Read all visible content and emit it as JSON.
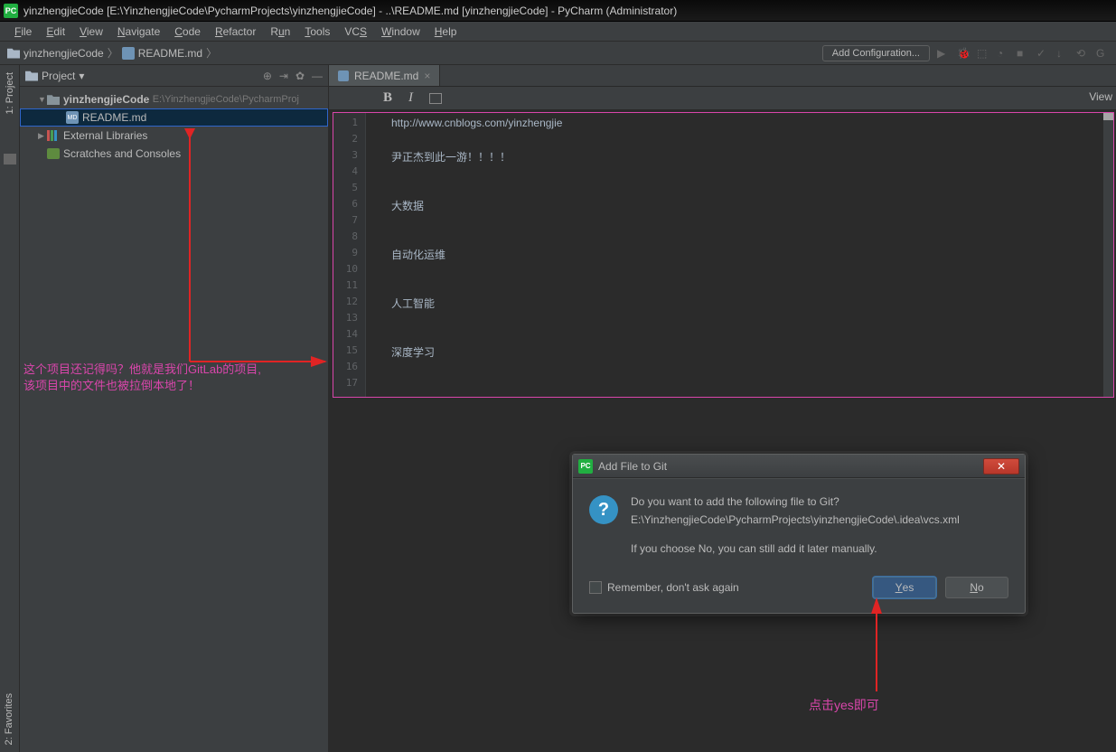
{
  "titlebar": {
    "text": "yinzhengjieCode [E:\\YinzhengjieCode\\PycharmProjects\\yinzhengjieCode] - ..\\README.md [yinzhengjieCode] - PyCharm (Administrator)"
  },
  "menubar": {
    "file": "File",
    "edit": "Edit",
    "view": "View",
    "navigate": "Navigate",
    "code": "Code",
    "refactor": "Refactor",
    "run": "Run",
    "tools": "Tools",
    "vcs": "VCS",
    "window": "Window",
    "help": "Help"
  },
  "breadcrumb": {
    "root": "yinzhengjieCode",
    "file": "README.md"
  },
  "run": {
    "add_config": "Add Configuration..."
  },
  "left_gutter": {
    "project_label": "1: Project",
    "favorites_label": "2: Favorites"
  },
  "project_header": {
    "label": "Project",
    "arrow": "▾"
  },
  "tree": {
    "root_name": "yinzhengjieCode",
    "root_path": "E:\\YinzhengjieCode\\PycharmProj",
    "readme": "README.md",
    "ext_libs": "External Libraries",
    "scratches": "Scratches and Consoles"
  },
  "annotation1_line1": "这个项目还记得吗？他就是我们GitLab的项目,",
  "annotation1_line2": "该项目中的文件也被拉倒本地了！",
  "editor": {
    "tab": "README.md",
    "view_label": "View",
    "lines": {
      "l1": "http://www.cnblogs.com/yinzhengjie",
      "l2": "",
      "l3": "尹正杰到此一游！！！！",
      "l4": "",
      "l5": "",
      "l6": "大数据",
      "l7": "",
      "l8": "",
      "l9": "自动化运维",
      "l10": "",
      "l11": "",
      "l12": "人工智能",
      "l13": "",
      "l14": "",
      "l15": "深度学习",
      "l16": "",
      "l17": ""
    },
    "gutter": [
      "1",
      "2",
      "3",
      "4",
      "5",
      "6",
      "7",
      "8",
      "9",
      "10",
      "11",
      "12",
      "13",
      "14",
      "15",
      "16",
      "17"
    ]
  },
  "dialog": {
    "title": "Add File to Git",
    "line1": "Do you want to add the following file to Git?",
    "line2": "E:\\YinzhengjieCode\\PycharmProjects\\yinzhengjieCode\\.idea\\vcs.xml",
    "line3": "If you choose No, you can still add it later manually.",
    "remember": "Remember, don't ask again",
    "yes": "Yes",
    "no": "No"
  },
  "annotation2": "点击yes即可"
}
